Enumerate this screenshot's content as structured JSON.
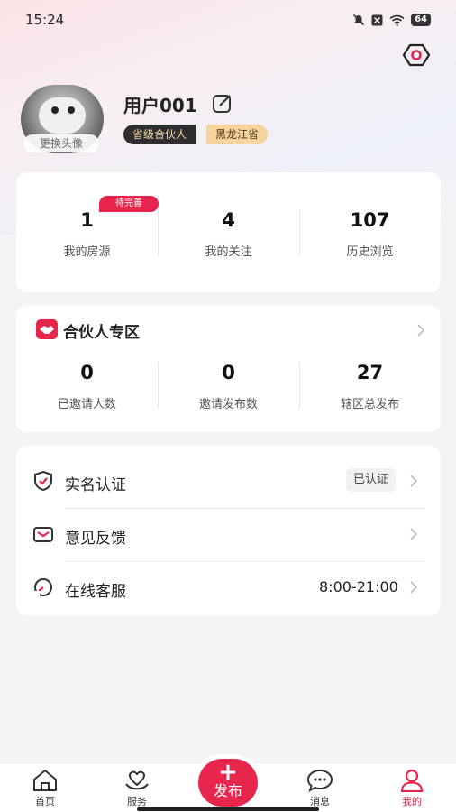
{
  "status_bar": {
    "time": "15:24",
    "battery": "64"
  },
  "profile": {
    "username": "用户001",
    "avatar_change_label": "更换头像",
    "level_badge": "省级合伙人",
    "region_badge": "黑龙江省"
  },
  "stats": {
    "pending_tag": "待完善",
    "items": [
      {
        "value": "1",
        "label": "我的房源"
      },
      {
        "value": "4",
        "label": "我的关注"
      },
      {
        "value": "107",
        "label": "历史浏览"
      }
    ]
  },
  "partner": {
    "title": "合伙人专区",
    "items": [
      {
        "value": "0",
        "label": "已邀请人数"
      },
      {
        "value": "0",
        "label": "邀请发布数"
      },
      {
        "value": "27",
        "label": "辖区总发布"
      }
    ]
  },
  "menu": {
    "items": [
      {
        "label": "实名认证",
        "value": "已认证"
      },
      {
        "label": "意见反馈",
        "value": ""
      },
      {
        "label": "在线客服",
        "value": "8:00-21:00"
      }
    ]
  },
  "tabbar": {
    "items": [
      {
        "label": "首页",
        "icon": "home-icon"
      },
      {
        "label": "服务",
        "icon": "service-icon"
      },
      {
        "label": "消息",
        "icon": "message-icon"
      },
      {
        "label": "我的",
        "icon": "profile-icon"
      }
    ],
    "publish": {
      "plus": "+",
      "label": "发布"
    }
  },
  "colors": {
    "accent": "#e8264d",
    "badge_dark": "#2f2d2f",
    "badge_gold": "#f8d39d"
  }
}
